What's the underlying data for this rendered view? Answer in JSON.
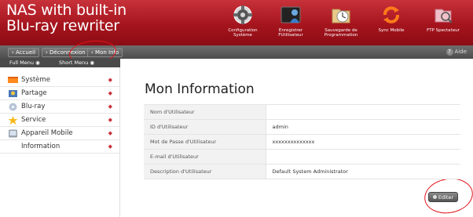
{
  "header": {
    "brand_line1": "NAS with built-in",
    "brand_line2": "Blu-ray rewriter",
    "nav": [
      {
        "label": "Configuration\nSystème",
        "icon": "gear-icon"
      },
      {
        "label": "Enregistrer\nFUtilisateur",
        "icon": "user-register-icon"
      },
      {
        "label": "Sauvegarde de\nProgrammation",
        "icon": "backup-schedule-icon"
      },
      {
        "label": "Sync Mobile",
        "icon": "sync-icon"
      },
      {
        "label": "FTP Spectateur",
        "icon": "ftp-icon"
      }
    ]
  },
  "toolbar": {
    "home": "› Accueil",
    "logout": "› Déconnexion",
    "myinfo": "› Mon Info",
    "help": "Aide"
  },
  "menu_switch": {
    "full": "Full Menu ◉",
    "short": "Short Menu ◉"
  },
  "sidebar": {
    "items": [
      {
        "label": "Système",
        "icon": "system-icon"
      },
      {
        "label": "Partage",
        "icon": "share-icon"
      },
      {
        "label": "Blu-ray",
        "icon": "disc-icon"
      },
      {
        "label": "Service",
        "icon": "star-icon"
      },
      {
        "label": "Appareil Mobile",
        "icon": "mobile-device-icon"
      },
      {
        "label": "Information",
        "icon": ""
      }
    ],
    "arrow": "◆"
  },
  "main": {
    "title": "Mon Information",
    "rows": [
      {
        "key": "Nom d'Utilisateur",
        "value": ""
      },
      {
        "key": "ID d'Utilisateur",
        "value": "admin"
      },
      {
        "key": "Mot de Passe d'Utilisateur",
        "value": "xxxxxxxxxxxxxx"
      },
      {
        "key": "E-mail d'Utilisateur",
        "value": ""
      },
      {
        "key": "Description d'Utilisateur",
        "value": "Default System Administrator"
      }
    ],
    "edit_label": "Editer"
  },
  "colors": {
    "header_red": "#a5141d",
    "toolbar_gray": "#555555",
    "annotation_red": "#e3141c"
  }
}
